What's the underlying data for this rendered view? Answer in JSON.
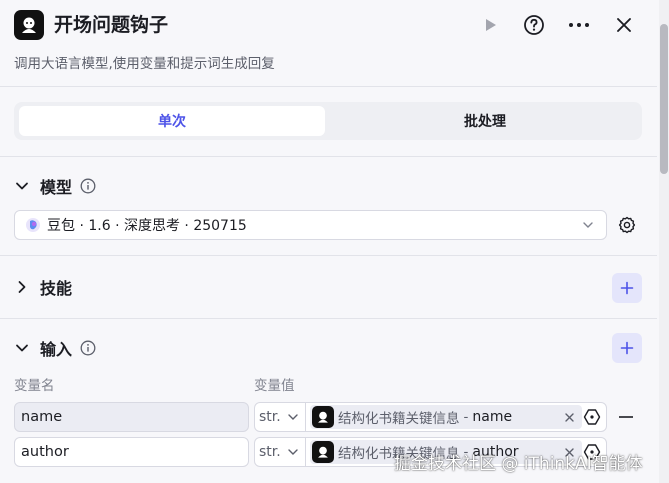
{
  "header": {
    "title": "开场问题钩子",
    "subtitle": "调用大语言模型,使用变量和提示词生成回复",
    "icons": [
      "bot-icon",
      "run-icon",
      "help-icon",
      "more-icon",
      "close-icon"
    ]
  },
  "tabs": [
    {
      "label": "单次",
      "active": true
    },
    {
      "label": "批处理",
      "active": false
    }
  ],
  "sections": {
    "model": {
      "label": "模型",
      "selected": "豆包 · 1.6 · 深度思考 · 250715"
    },
    "skills": {
      "label": "技能"
    },
    "input": {
      "label": "输入"
    }
  },
  "input_table": {
    "col_name": "变量名",
    "col_value": "变量值",
    "rows": [
      {
        "name": "name",
        "type": "str.",
        "source": "结构化书籍关键信息",
        "sep": "-",
        "variable": "name"
      },
      {
        "name": "author",
        "type": "str.",
        "source": "结构化书籍关键信息",
        "sep": "-",
        "variable": "author"
      }
    ]
  },
  "watermark": "掘金技术社区 @ iThinkAI智能体",
  "colors": {
    "accent": "#4d53e8",
    "plus_bg": "#e4e5fb",
    "background": "#f7f7fa"
  }
}
